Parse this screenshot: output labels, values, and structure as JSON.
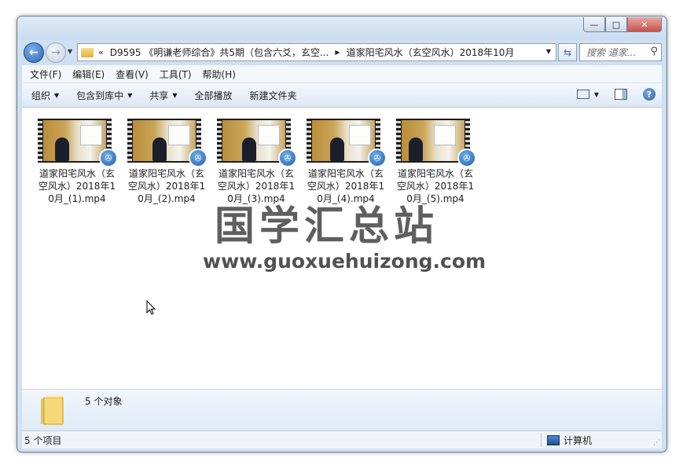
{
  "window": {
    "caption": {
      "minimize": "—",
      "maximize": "□",
      "close": "✕"
    }
  },
  "address": {
    "chevron": "«",
    "segment1": "D9595 《明谦老师综合》共5期（包含六爻，玄空...",
    "separator": "▶",
    "segment2": "道家阳宅风水（玄空风水）2018年10月",
    "dropdown": "▼"
  },
  "search": {
    "placeholder": "搜索 道家..."
  },
  "menu": {
    "items": [
      "文件(F)",
      "编辑(E)",
      "查看(V)",
      "工具(T)",
      "帮助(H)"
    ]
  },
  "toolbar": {
    "organize": "组织",
    "include_library": "包含到库中",
    "share": "共享",
    "play_all": "全部播放",
    "new_folder": "新建文件夹",
    "help": "?"
  },
  "files": [
    {
      "name": "道家阳宅风水（玄空风水）2018年10月_(1).mp4"
    },
    {
      "name": "道家阳宅风水（玄空风水）2018年10月_(2).mp4"
    },
    {
      "name": "道家阳宅风水（玄空风水）2018年10月_(3).mp4"
    },
    {
      "name": "道家阳宅风水（玄空风水）2018年10月_(4).mp4"
    },
    {
      "name": "道家阳宅风水（玄空风水）2018年10月_(5).mp4"
    }
  ],
  "watermark": {
    "chinese": "国学汇总站",
    "url": "www.guoxuehuizong.com"
  },
  "details": {
    "count": "5 个对象"
  },
  "status": {
    "items": "5 个项目",
    "location": "计算机"
  },
  "icons": {
    "back": "back-arrow-icon",
    "forward": "forward-arrow-icon",
    "search": "magnifier-icon",
    "video_badge": "film-reel-icon"
  },
  "colors": {
    "frame": "#cfe0f3",
    "toolbar": "#dbe7f4",
    "close": "#c75050"
  }
}
